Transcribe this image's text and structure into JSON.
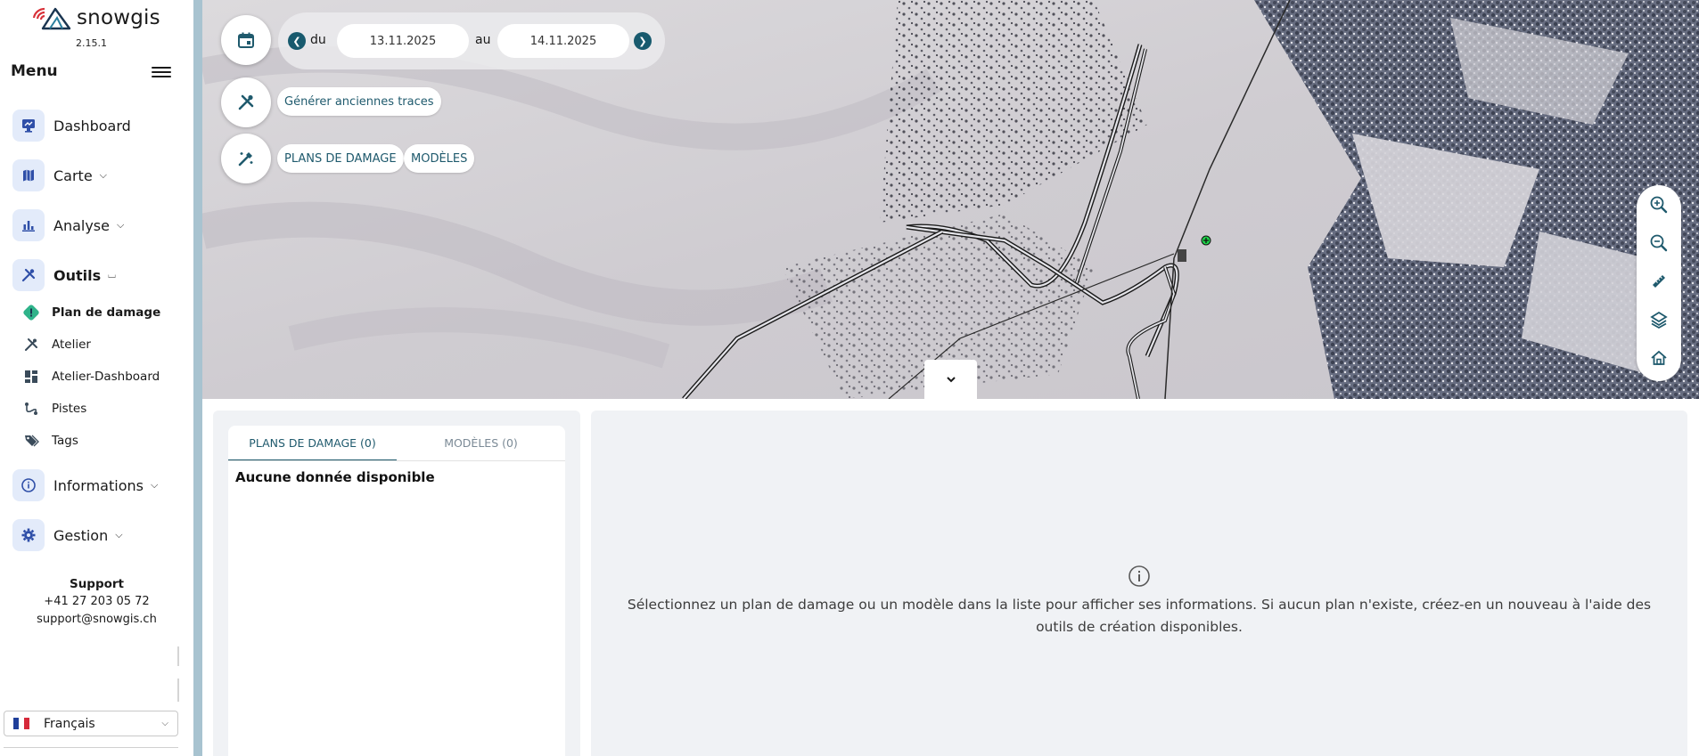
{
  "app": {
    "brand": "snowgis",
    "version": "2.15.1"
  },
  "sidebar": {
    "menu_title": "Menu",
    "items": [
      {
        "label": "Dashboard"
      },
      {
        "label": "Carte"
      },
      {
        "label": "Analyse"
      },
      {
        "label": "Outils"
      },
      {
        "label": "Informations"
      },
      {
        "label": "Gestion"
      }
    ],
    "sub_items": [
      {
        "label": "Plan de damage"
      },
      {
        "label": "Atelier"
      },
      {
        "label": "Atelier-Dashboard"
      },
      {
        "label": "Pistes"
      },
      {
        "label": "Tags"
      }
    ],
    "support": {
      "title": "Support",
      "phone": "+41 27 203 05 72",
      "email": "support@snowgis.ch"
    },
    "language": "Français"
  },
  "map_controls": {
    "date_from_label": "du",
    "date_from": "13.11.2025",
    "date_to_label": "au",
    "date_to": "14.11.2025",
    "generate_traces": "Générer anciennes traces",
    "plans_button": "PLANS DE DAMAGE",
    "models_button": "MODÈLES"
  },
  "panel": {
    "tab_plans": "PLANS DE DAMAGE (0)",
    "tab_models": "MODÈLES (0)",
    "empty_text": "Aucune donnée disponible",
    "info_text": "Sélectionnez un plan de damage ou un modèle dans la liste pour afficher ses informations. Si aucun plan n'existe, créez-en un nouveau à l'aide des outils de création disponibles."
  },
  "colors": {
    "accent": "#1f5a6d",
    "icon_bg": "#e3ebfa",
    "icon_blue": "#2f4fa8",
    "sidebar_edge": "#a8c3d0",
    "panel_bg": "#f0f2f5"
  }
}
